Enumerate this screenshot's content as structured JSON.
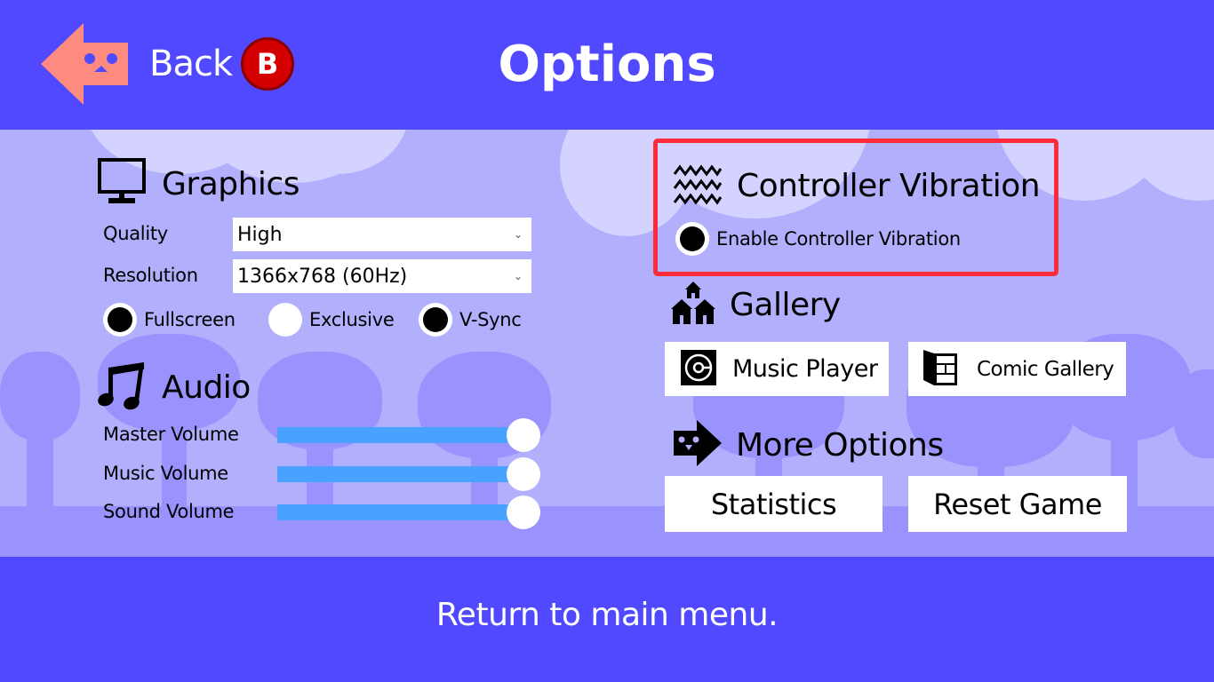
{
  "header": {
    "title": "Options",
    "back_label": "Back",
    "back_key": "B"
  },
  "graphics": {
    "title": "Graphics",
    "quality_label": "Quality",
    "quality_value": "High",
    "resolution_label": "Resolution",
    "resolution_value": "1366x768 (60Hz)",
    "toggles": [
      {
        "label": "Fullscreen",
        "checked": true
      },
      {
        "label": "Exclusive",
        "checked": false
      },
      {
        "label": "V-Sync",
        "checked": true
      }
    ]
  },
  "audio": {
    "title": "Audio",
    "sliders": [
      {
        "label": "Master Volume",
        "value_percent": 100
      },
      {
        "label": "Music Volume",
        "value_percent": 100
      },
      {
        "label": "Sound Volume",
        "value_percent": 100
      }
    ]
  },
  "vibration": {
    "title": "Controller Vibration",
    "toggle_label": "Enable Controller Vibration",
    "checked": true,
    "highlight_color": "#ff2b3a"
  },
  "gallery": {
    "title": "Gallery",
    "music_player_label": "Music Player",
    "comic_gallery_label": "Comic Gallery"
  },
  "more": {
    "title": "More Options",
    "statistics_label": "Statistics",
    "reset_label": "Reset Game"
  },
  "footer": {
    "hint": "Return to main menu."
  },
  "colors": {
    "bar": "#5149ff",
    "background": "#b2b0fd",
    "slider_fill": "#49a2ff",
    "back_arrow": "#ff8a80",
    "key_badge": "#d40000"
  }
}
